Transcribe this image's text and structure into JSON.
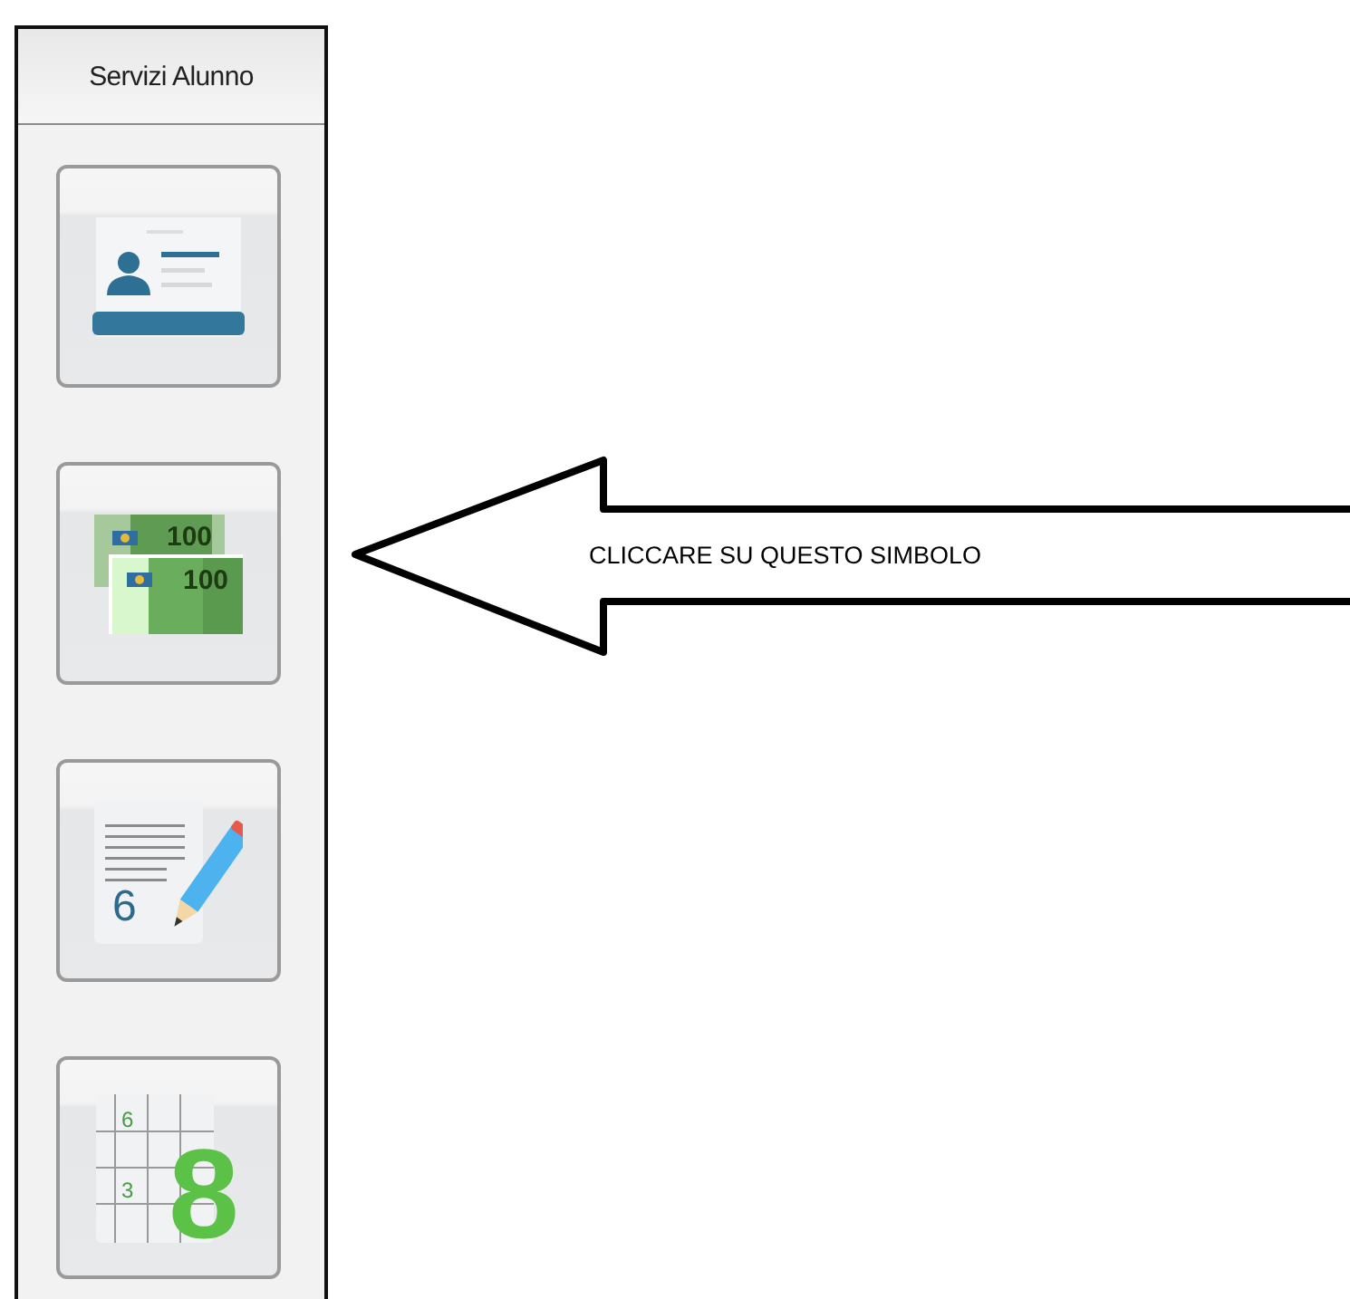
{
  "panel": {
    "title": "Servizi Alunno",
    "buttons": [
      {
        "kind": "id-card"
      },
      {
        "kind": "money",
        "marks": [
          "100",
          "100"
        ]
      },
      {
        "kind": "grades",
        "marks": [
          "6"
        ]
      },
      {
        "kind": "gradebook",
        "marks": [
          "6",
          "3",
          "8"
        ]
      }
    ]
  },
  "callout": {
    "text": "CLICCARE SU QUESTO SIMBOLO"
  }
}
